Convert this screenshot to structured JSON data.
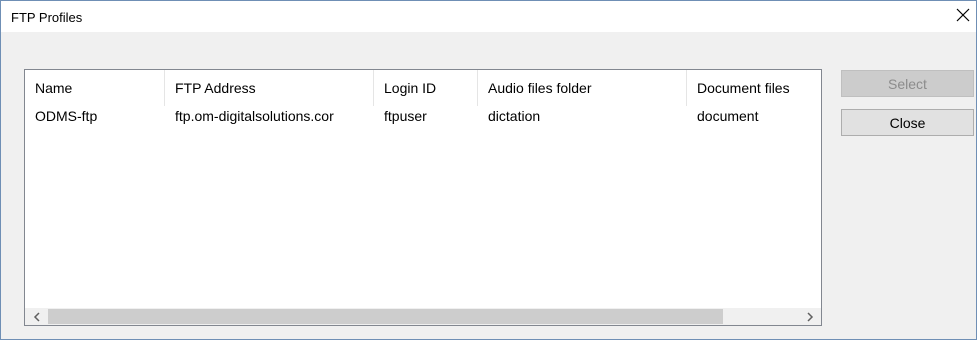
{
  "window": {
    "title": "FTP Profiles"
  },
  "table": {
    "columns": [
      "Name",
      "FTP Address",
      "Login ID",
      "Audio files folder",
      "Document files"
    ],
    "rows": [
      [
        "ODMS-ftp",
        "ftp.om-digitalsolutions.cor",
        "ftpuser",
        "dictation",
        "document"
      ]
    ]
  },
  "buttons": {
    "select_label": "Select",
    "close_label": "Close"
  },
  "icons": {
    "close": "close-icon",
    "scroll_left": "scroll-left-arrow-icon",
    "scroll_right": "scroll-right-arrow-icon"
  },
  "colors": {
    "window_border": "#6f8fb5",
    "dialog_bg": "#f0f0f0",
    "button_disabled_bg": "#cccccc",
    "button_bg": "#e1e1e1"
  }
}
